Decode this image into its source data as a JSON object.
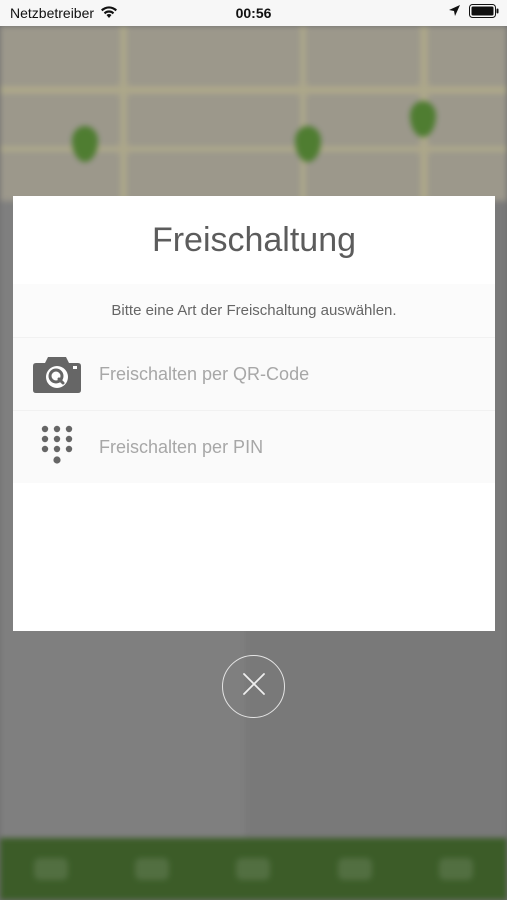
{
  "status_bar": {
    "carrier": "Netzbetreiber",
    "time": "00:56"
  },
  "modal": {
    "title": "Freischaltung",
    "subtitle": "Bitte eine Art der Freischaltung auswählen.",
    "options": [
      {
        "label": "Freischalten per QR-Code",
        "icon": "camera-qr-icon"
      },
      {
        "label": "Freischalten per PIN",
        "icon": "keypad-icon"
      }
    ]
  },
  "close": {
    "icon": "close-icon"
  },
  "colors": {
    "tab_bar": "#3c6e1e",
    "map_pin": "#5aa02c",
    "icon_gray": "#666666"
  }
}
